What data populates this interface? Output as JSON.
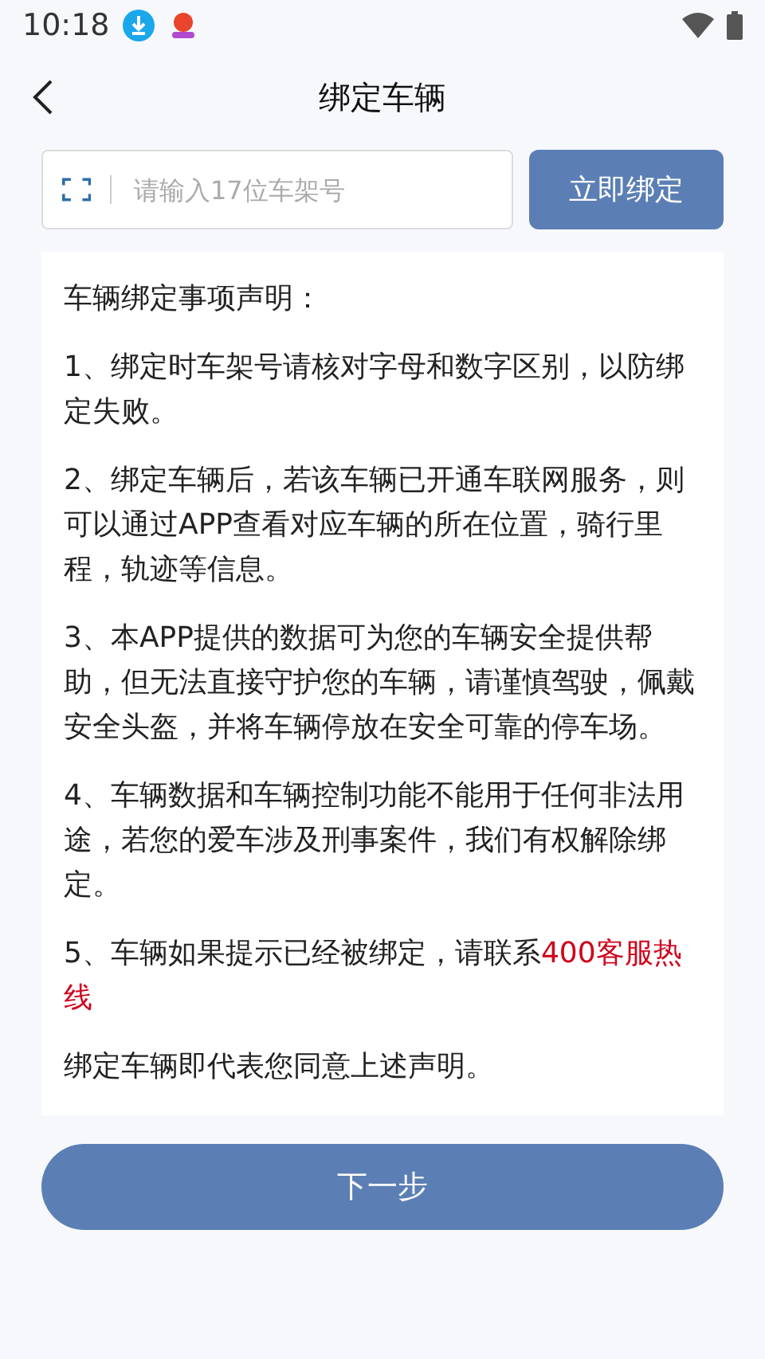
{
  "status_bar": {
    "time": "10:18"
  },
  "header": {
    "title": "绑定车辆"
  },
  "bind_form": {
    "placeholder": "请输入17位车架号",
    "button": "立即绑定"
  },
  "notice": {
    "title": "车辆绑定事项声明：",
    "paragraphs": [
      {
        "text": "1、绑定时车架号请核对字母和数字区别，以防绑定失败。"
      },
      {
        "text": "2、绑定车辆后，若该车辆已开通车联网服务，则可以通过APP查看对应车辆的所在位置，骑行里程，轨迹等信息。"
      },
      {
        "text": "3、本APP提供的数据可为您的车辆安全提供帮助，但无法直接守护您的车辆，请谨慎驾驶，佩戴安全头盔，并将车辆停放在安全可靠的停车场。"
      },
      {
        "text": "4、车辆数据和车辆控制功能不能用于任何非法用途，若您的爱车涉及刑事案件，我们有权解除绑定。"
      },
      {
        "text": "5、车辆如果提示已经被绑定，请联系",
        "highlight": "400客服热线"
      }
    ],
    "footer": "绑定车辆即代表您同意上述声明。"
  },
  "next_button": "下一步"
}
